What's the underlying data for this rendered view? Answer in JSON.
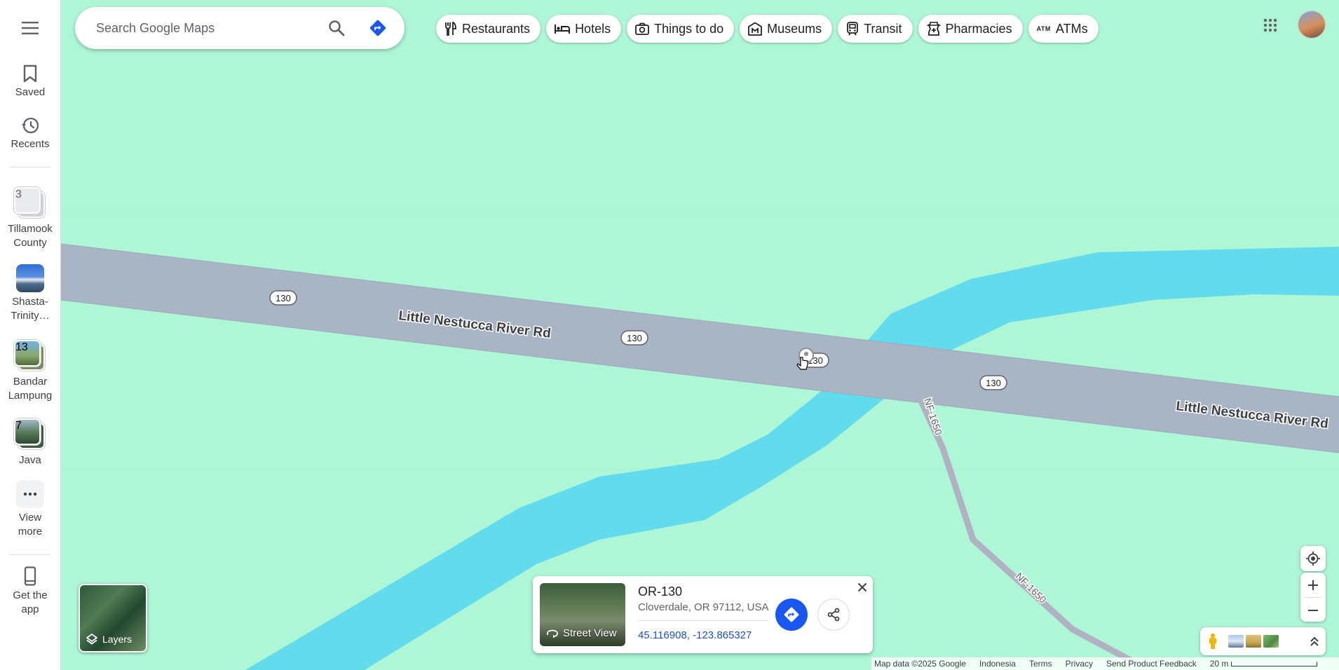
{
  "search": {
    "placeholder": "Search Google Maps"
  },
  "chips": [
    {
      "label": "Restaurants",
      "icon": "fork-knife-icon"
    },
    {
      "label": "Hotels",
      "icon": "bed-icon"
    },
    {
      "label": "Things to do",
      "icon": "camera-icon"
    },
    {
      "label": "Museums",
      "icon": "museum-icon"
    },
    {
      "label": "Transit",
      "icon": "train-icon"
    },
    {
      "label": "Pharmacies",
      "icon": "pharmacy-icon"
    },
    {
      "label": "ATMs",
      "icon": "atm-icon",
      "icon_text": "ATM"
    }
  ],
  "rail": {
    "saved": "Saved",
    "recents": "Recents",
    "recent_places": [
      {
        "label": "Tillamook County",
        "count": "3"
      },
      {
        "label": "Shasta-Trinity…"
      },
      {
        "label": "Bandar Lampung",
        "count": "13"
      },
      {
        "label": "Java",
        "count": "7"
      }
    ],
    "view_more": "View more",
    "get_app": "Get the app"
  },
  "map": {
    "road_name": "Little Nestucca River Rd",
    "route_shields": [
      "130",
      "130",
      "130",
      "130"
    ],
    "forest_road": "NF-1650",
    "colors": {
      "land": "#aef7d6",
      "road": "#a9b5c5",
      "river": "#62dcec",
      "forest_road": "#b0b2c2"
    }
  },
  "layers": {
    "label": "Layers"
  },
  "card": {
    "title": "OR-130",
    "address": "Cloverdale, OR 97112, USA",
    "coords": "45.116908, -123.865327",
    "street_view": "Street View"
  },
  "footer": {
    "map_data": "Map data ©2025 Google",
    "region": "Indonesia",
    "terms": "Terms",
    "privacy": "Privacy",
    "feedback": "Send Product Feedback",
    "scale": "20 m"
  }
}
